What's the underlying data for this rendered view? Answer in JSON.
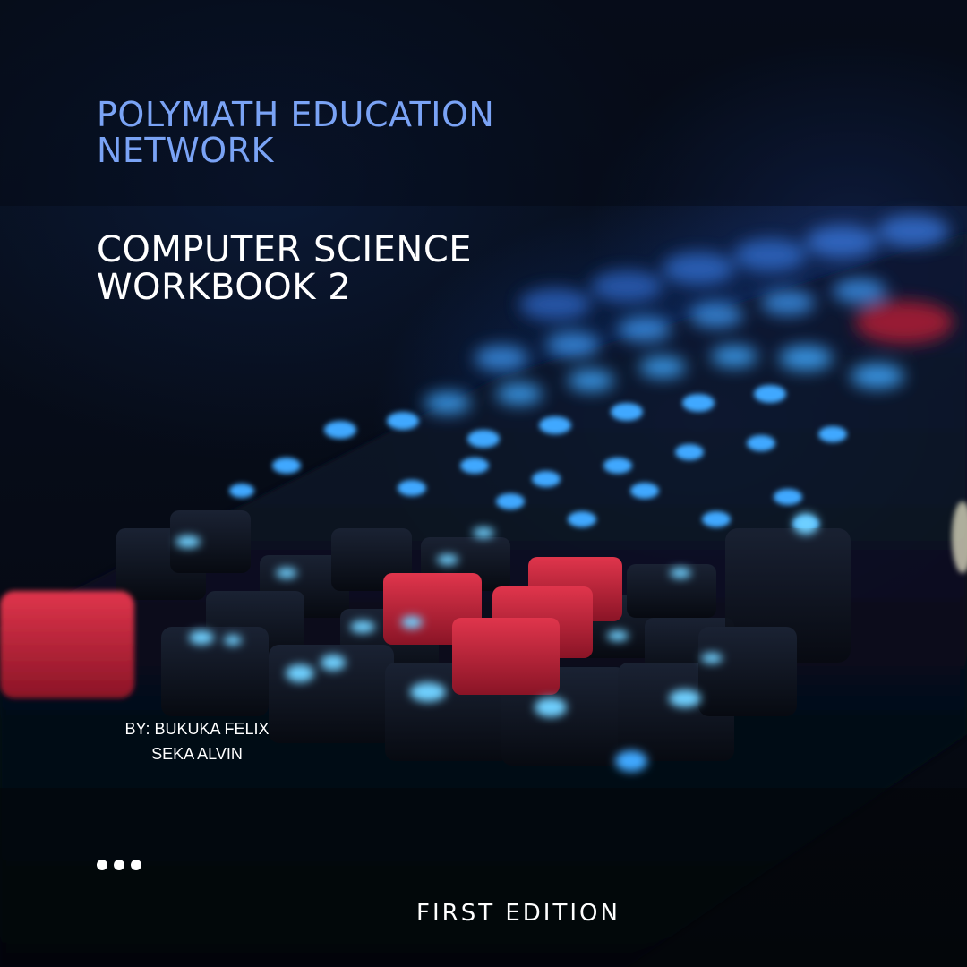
{
  "organization": {
    "line1": "POLYMATH EDUCATION",
    "line2": "NETWORK"
  },
  "title": {
    "line1": "COMPUTER SCIENCE",
    "line2": "WORKBOOK 2"
  },
  "authors": {
    "line1": "BY: BUKUKA FELIX",
    "line2": "SEKA ALVIN"
  },
  "edition": "FIRST EDITION",
  "decoration": {
    "dots_icon": "ellipsis-icon",
    "dot_count": 3
  },
  "colors": {
    "background": "#05080f",
    "organization_text": "#7aa3f5",
    "title_text": "#ffffff",
    "key_glow": "#3fa8ff",
    "accent_key": "#c8243a"
  }
}
